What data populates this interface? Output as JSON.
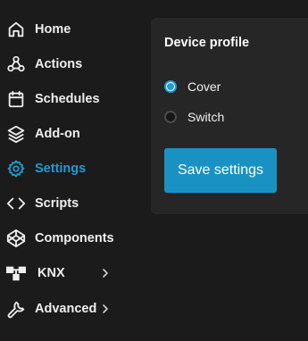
{
  "sidebar": {
    "items": [
      {
        "id": "home",
        "label": "Home",
        "icon": "home-icon",
        "active": false
      },
      {
        "id": "actions",
        "label": "Actions",
        "icon": "webhook-icon",
        "active": false
      },
      {
        "id": "schedules",
        "label": "Schedules",
        "icon": "calendar-icon",
        "active": false
      },
      {
        "id": "addon",
        "label": "Add-on",
        "icon": "layers-icon",
        "active": false
      },
      {
        "id": "settings",
        "label": "Settings",
        "icon": "gear-icon",
        "active": true
      },
      {
        "id": "scripts",
        "label": "Scripts",
        "icon": "code-icon",
        "active": false
      },
      {
        "id": "components",
        "label": "Components",
        "icon": "codepen-icon",
        "active": false
      },
      {
        "id": "knx",
        "label": "KNX",
        "icon": "network-icon",
        "active": false,
        "expandable": true
      },
      {
        "id": "advanced",
        "label": "Advanced",
        "icon": "wrench-icon",
        "active": false,
        "expandable": true
      }
    ]
  },
  "panel": {
    "title": "Device profile",
    "options": [
      {
        "label": "Cover",
        "checked": true
      },
      {
        "label": "Switch",
        "checked": false
      }
    ],
    "save_label": "Save settings"
  },
  "colors": {
    "accent": "#1d9bd1",
    "button": "#1992c3",
    "background": "#1b1b1b",
    "panel": "#262626"
  }
}
